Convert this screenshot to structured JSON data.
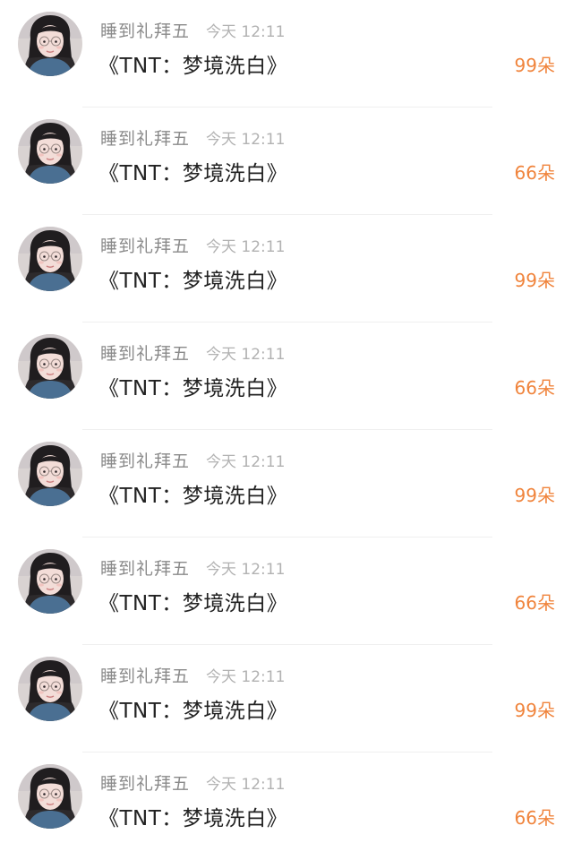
{
  "colors": {
    "accent": "#f0843c",
    "username": "#8a8a8a",
    "timestamp": "#b2b2b2",
    "message": "#222222",
    "divider": "#efefef"
  },
  "entries": [
    {
      "username": "睡到礼拜五",
      "time": "今天 12:11",
      "message": "《TNT：梦境洗白》",
      "gift": "99朵"
    },
    {
      "username": "睡到礼拜五",
      "time": "今天 12:11",
      "message": "《TNT：梦境洗白》",
      "gift": "66朵"
    },
    {
      "username": "睡到礼拜五",
      "time": "今天 12:11",
      "message": "《TNT：梦境洗白》",
      "gift": "99朵"
    },
    {
      "username": "睡到礼拜五",
      "time": "今天 12:11",
      "message": "《TNT：梦境洗白》",
      "gift": "66朵"
    },
    {
      "username": "睡到礼拜五",
      "time": "今天 12:11",
      "message": "《TNT：梦境洗白》",
      "gift": "99朵"
    },
    {
      "username": "睡到礼拜五",
      "time": "今天 12:11",
      "message": "《TNT：梦境洗白》",
      "gift": "66朵"
    },
    {
      "username": "睡到礼拜五",
      "time": "今天 12:11",
      "message": "《TNT：梦境洗白》",
      "gift": "99朵"
    },
    {
      "username": "睡到礼拜五",
      "time": "今天 12:11",
      "message": "《TNT：梦境洗白》",
      "gift": "66朵"
    }
  ]
}
